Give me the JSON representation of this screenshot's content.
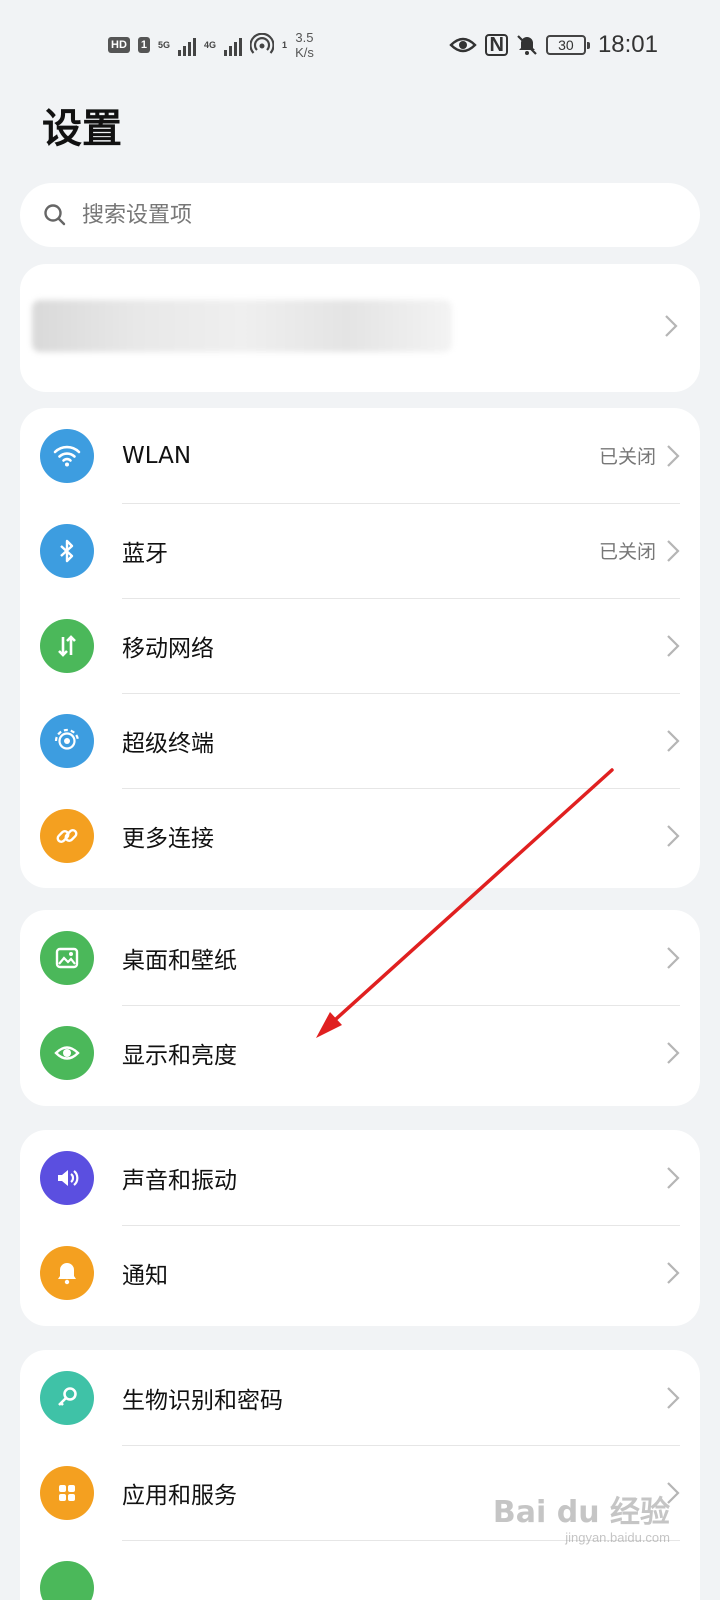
{
  "status_bar": {
    "hd_badge": "HD",
    "sim_badge": "1",
    "net_5g": "5G",
    "net_4g": "4G",
    "hotspot_count": "1",
    "speed_value": "3.5",
    "speed_unit": "K/s",
    "nfc_label": "N",
    "battery": "30",
    "time": "18:01"
  },
  "page": {
    "title": "设置"
  },
  "search": {
    "placeholder": "搜索设置项"
  },
  "groups": {
    "connectivity": [
      {
        "label": "WLAN",
        "value": "已关闭",
        "icon": "wifi-icon",
        "color": "#3d9de0"
      },
      {
        "label": "蓝牙",
        "value": "已关闭",
        "icon": "bluetooth-icon",
        "color": "#3d9de0"
      },
      {
        "label": "移动网络",
        "value": "",
        "icon": "mobile-data-icon",
        "color": "#4bb85a"
      },
      {
        "label": "超级终端",
        "value": "",
        "icon": "super-device-icon",
        "color": "#3d9de0"
      },
      {
        "label": "更多连接",
        "value": "",
        "icon": "link-icon",
        "color": "#f4a020"
      }
    ],
    "display": [
      {
        "label": "桌面和壁纸",
        "icon": "wallpaper-icon",
        "color": "#4bb85a"
      },
      {
        "label": "显示和亮度",
        "icon": "eye-icon",
        "color": "#4bb85a"
      }
    ],
    "sound": [
      {
        "label": "声音和振动",
        "icon": "volume-icon",
        "color": "#5b4fe0"
      },
      {
        "label": "通知",
        "icon": "bell-icon",
        "color": "#f4a020"
      }
    ],
    "security": [
      {
        "label": "生物识别和密码",
        "icon": "key-icon",
        "color": "#3fc2a7"
      },
      {
        "label": "应用和服务",
        "icon": "apps-icon",
        "color": "#f4a020"
      }
    ]
  },
  "colors": {
    "annotation_arrow": "#e02020",
    "background": "#f1f3f5"
  },
  "watermark": {
    "main": "Bai du 经验",
    "sub": "jingyan.baidu.com"
  }
}
